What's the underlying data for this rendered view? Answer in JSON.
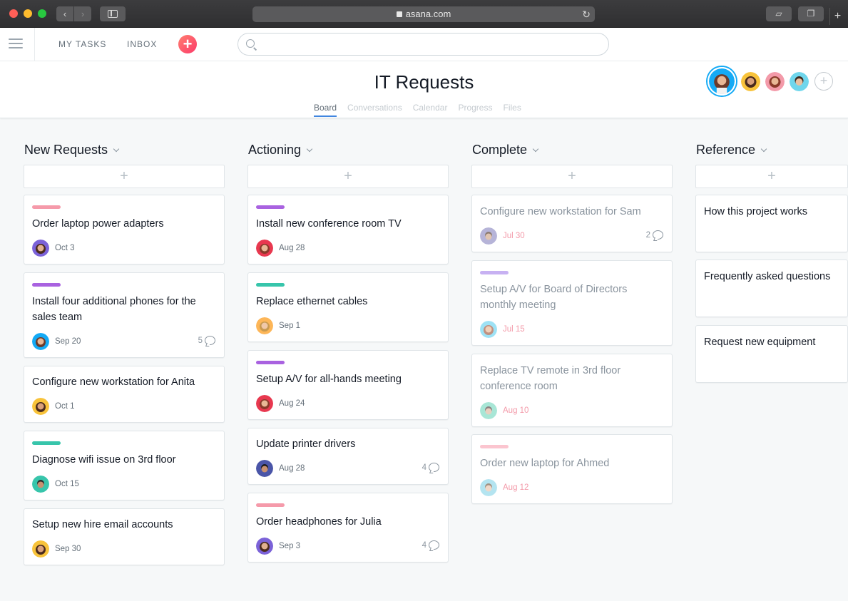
{
  "browser": {
    "url": "asana.com",
    "back_icon": "chevron-left-icon",
    "forward_icon": "chevron-right-icon",
    "reload_icon": "reload-icon"
  },
  "topbar": {
    "my_tasks": "MY TASKS",
    "inbox": "INBOX",
    "add_label": "+",
    "search_placeholder": ""
  },
  "project": {
    "title": "IT Requests",
    "tabs": [
      "Board",
      "Conversations",
      "Calendar",
      "Progress",
      "Files"
    ],
    "active_tab": "Board",
    "member_add": "+"
  },
  "colors": {
    "pink": "#f59aaa",
    "purple": "#a962e0",
    "teal": "#37c5ab",
    "lavender": "#c7b1f2",
    "light_pink": "#fbc5cf",
    "accent": "#4186e0",
    "add_button": "#fc636b"
  },
  "board": {
    "add_label": "+",
    "columns": [
      {
        "title": "New Requests",
        "cards": [
          {
            "title": "Order laptop power adapters",
            "due": "Oct 3",
            "tag": "pink",
            "comments": ""
          },
          {
            "title": "Install four additional phones for the sales team",
            "due": "Sep 20",
            "tag": "purple",
            "comments": "5"
          },
          {
            "title": "Configure new workstation for Anita",
            "due": "Oct 1",
            "tag": "",
            "comments": ""
          },
          {
            "title": "Diagnose wifi issue on 3rd floor",
            "due": "Oct 15",
            "tag": "teal",
            "comments": ""
          },
          {
            "title": "Setup new hire email accounts",
            "due": "Sep 30",
            "tag": "",
            "comments": ""
          }
        ]
      },
      {
        "title": "Actioning",
        "cards": [
          {
            "title": "Install new conference room TV",
            "due": "Aug 28",
            "tag": "purple",
            "comments": ""
          },
          {
            "title": "Replace ethernet cables",
            "due": "Sep 1",
            "tag": "teal",
            "comments": ""
          },
          {
            "title": "Setup A/V for all-hands meeting",
            "due": "Aug 24",
            "tag": "purple",
            "comments": ""
          },
          {
            "title": "Update printer drivers",
            "due": "Aug 28",
            "tag": "",
            "comments": "4"
          },
          {
            "title": "Order headphones for Julia",
            "due": "Sep 3",
            "tag": "pink",
            "comments": "4"
          }
        ]
      },
      {
        "title": "Complete",
        "cards": [
          {
            "title": "Configure new workstation for Sam",
            "due": "Jul 30",
            "tag": "",
            "comments": "2"
          },
          {
            "title": "Setup A/V for Board of Directors monthly meeting",
            "due": "Jul 15",
            "tag": "lavender",
            "comments": ""
          },
          {
            "title": "Replace TV remote in 3rd floor conference room",
            "due": "Aug 10",
            "tag": "",
            "comments": ""
          },
          {
            "title": "Order new laptop for Ahmed",
            "due": "Aug 12",
            "tag": "light_pink",
            "comments": ""
          }
        ]
      },
      {
        "title": "Reference",
        "cards": [
          {
            "title": "How this project works"
          },
          {
            "title": "Frequently asked questions"
          },
          {
            "title": "Request new equipment"
          }
        ]
      }
    ]
  }
}
